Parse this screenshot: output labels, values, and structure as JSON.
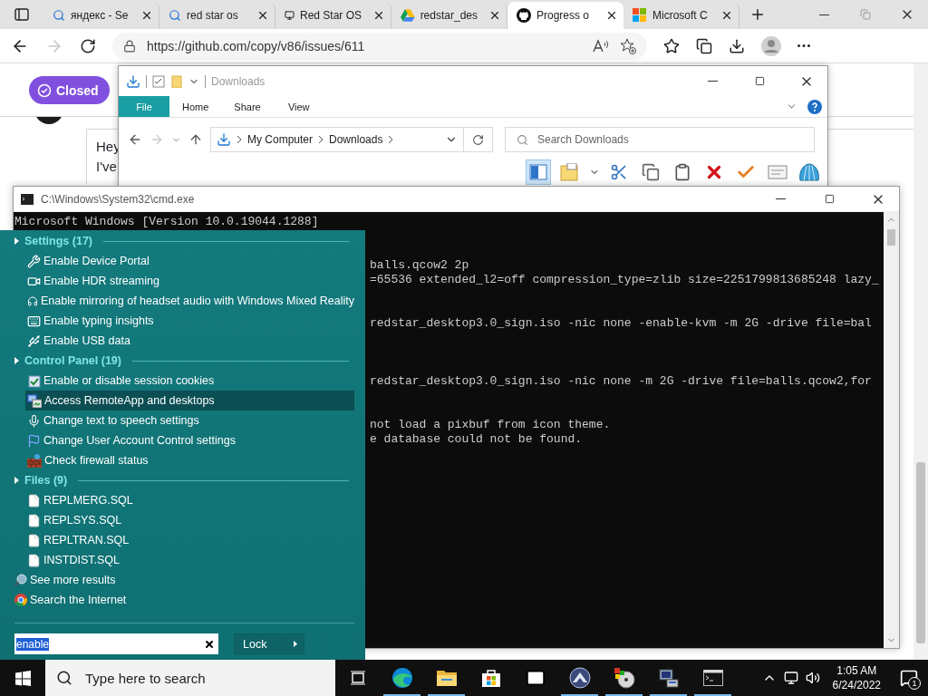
{
  "browser": {
    "tabs": [
      {
        "title": "яндекс - Se",
        "selected": false
      },
      {
        "title": "red star os",
        "selected": false
      },
      {
        "title": "Red Star OS",
        "selected": false
      },
      {
        "title": "redstar_des",
        "selected": false
      },
      {
        "title": "Progress o",
        "selected": true
      },
      {
        "title": "Microsoft C",
        "selected": false
      }
    ],
    "address": "https://github.com/copy/v86/issues/611",
    "page": {
      "state_badge": "Closed",
      "comment_lines": [
        "Hey",
        "I've"
      ]
    }
  },
  "explorer": {
    "title": "Downloads",
    "ribbon_tabs": [
      {
        "label": "File",
        "selected": true
      },
      {
        "label": "Home",
        "selected": false
      },
      {
        "label": "Share",
        "selected": false
      },
      {
        "label": "View",
        "selected": false
      }
    ],
    "breadcrumb": [
      "My Computer",
      "Downloads"
    ],
    "search": {
      "placeholder": "Search Downloads"
    }
  },
  "cmd": {
    "title": "C:\\Windows\\System32\\cmd.exe",
    "lines": [
      {
        "text": "Microsoft Windows [Version 10.0.19044.1288]"
      },
      {
        "text": "balls.qcow2 2p"
      },
      {
        "text": "=65536 extended_l2=off compression_type=zlib size=2251799813685248 lazy_"
      },
      {
        "text": "redstar_desktop3.0_sign.iso -nic none -enable-kvm -m 2G -drive file=bal"
      },
      {
        "text": "redstar_desktop3.0_sign.iso -nic none -m 2G -drive file=balls.qcow2,for"
      },
      {
        "text": "not load a pixbuf from icon theme."
      },
      {
        "text": "e database could not be found."
      }
    ]
  },
  "start_menu": {
    "groups": [
      {
        "label": "Settings (17)",
        "items": [
          {
            "label": "Enable Device Portal",
            "selected": false
          },
          {
            "label": "Enable HDR streaming",
            "selected": false
          },
          {
            "label": "Enable mirroring of headset audio with Windows Mixed Reality",
            "selected": false
          },
          {
            "label": "Enable typing insights",
            "selected": false
          },
          {
            "label": "Enable USB data",
            "selected": false
          }
        ]
      },
      {
        "label": "Control Panel (19)",
        "items": [
          {
            "label": "Enable or disable session cookies",
            "selected": false
          },
          {
            "label": "Access RemoteApp and desktops",
            "selected": true
          },
          {
            "label": "Change text to speech settings",
            "selected": false
          },
          {
            "label": "Change User Account Control settings",
            "selected": false
          },
          {
            "label": "Check firewall status",
            "selected": false
          }
        ]
      },
      {
        "label": "Files (9)",
        "items": [
          {
            "label": "REPLMERG.SQL",
            "selected": false
          },
          {
            "label": "REPLSYS.SQL",
            "selected": false
          },
          {
            "label": "REPLTRAN.SQL",
            "selected": false
          },
          {
            "label": "INSTDIST.SQL",
            "selected": false
          }
        ]
      }
    ],
    "links": [
      "See more results",
      "Search the Internet"
    ],
    "search": {
      "value": "enable"
    },
    "lock_button": "Lock"
  },
  "taskbar": {
    "search": {
      "placeholder": "Type here to search"
    },
    "apps": [
      {
        "running": false
      },
      {
        "running": true
      },
      {
        "running": true
      },
      {
        "running": false
      },
      {
        "running": false
      },
      {
        "running": true
      },
      {
        "running": true
      },
      {
        "running": true
      },
      {
        "running": true
      }
    ],
    "time": "1:05 AM",
    "date": "6/24/2022",
    "notification_count": "1"
  }
}
